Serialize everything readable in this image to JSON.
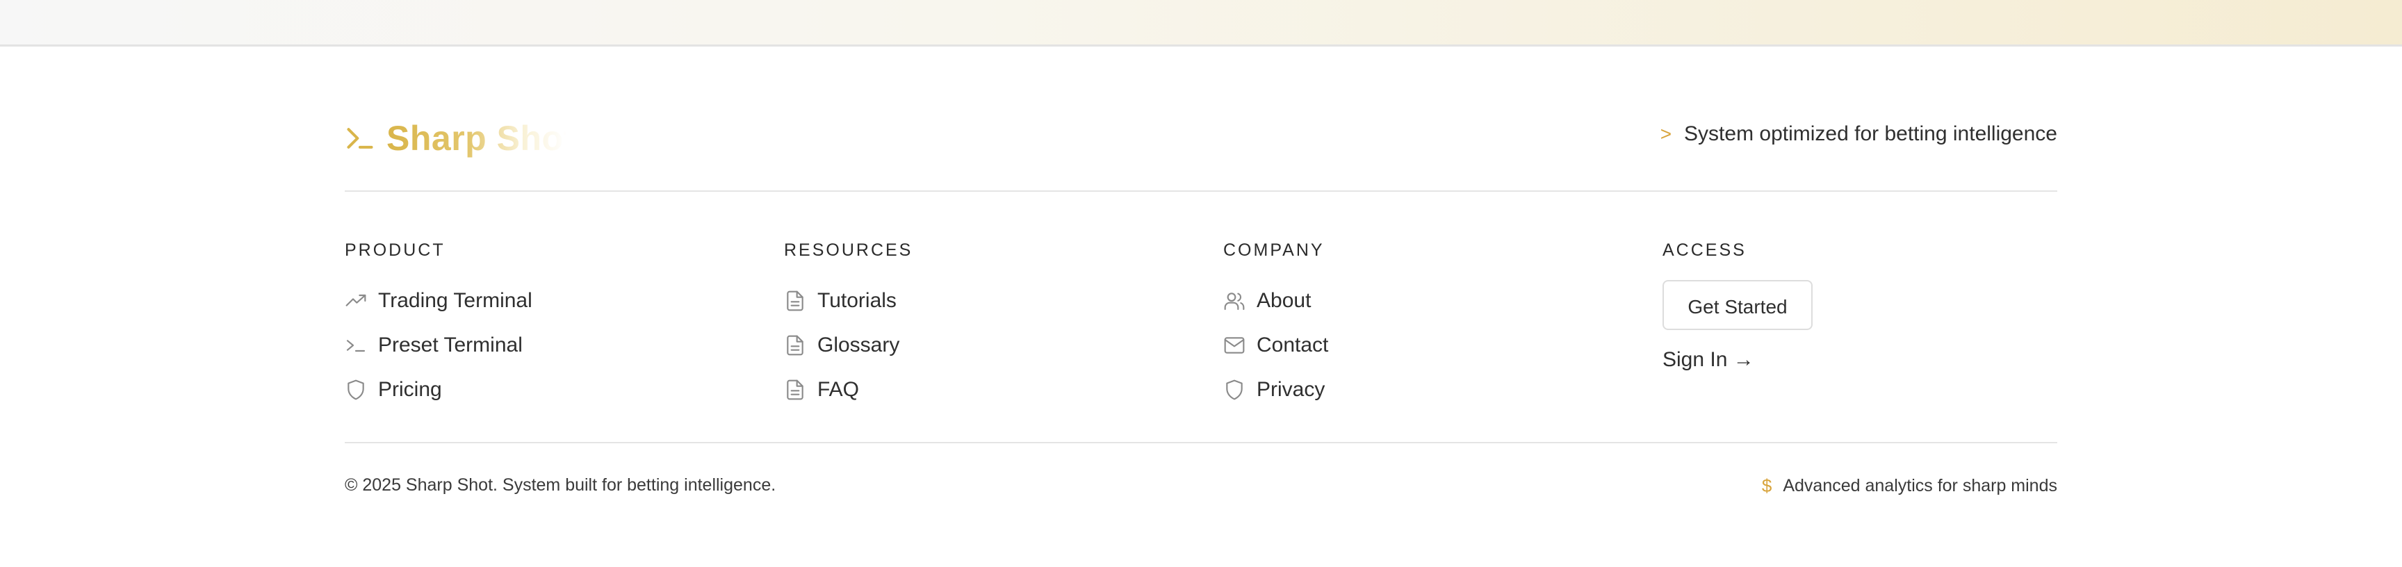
{
  "brand": {
    "name": "Sharp Shot",
    "icon": "terminal-prompt-icon",
    "accent": "#d9b54a"
  },
  "tagline": {
    "caret": ">",
    "text": "System optimized for betting intelligence"
  },
  "columns": {
    "product": {
      "heading": "PRODUCT",
      "items": [
        {
          "label": "Trading Terminal",
          "icon": "trending-up-icon"
        },
        {
          "label": "Preset Terminal",
          "icon": "terminal-icon"
        },
        {
          "label": "Pricing",
          "icon": "shield-icon"
        }
      ]
    },
    "resources": {
      "heading": "RESOURCES",
      "items": [
        {
          "label": "Tutorials",
          "icon": "document-icon"
        },
        {
          "label": "Glossary",
          "icon": "document-icon"
        },
        {
          "label": "FAQ",
          "icon": "document-icon"
        }
      ]
    },
    "company": {
      "heading": "COMPANY",
      "items": [
        {
          "label": "About",
          "icon": "users-icon"
        },
        {
          "label": "Contact",
          "icon": "mail-icon"
        },
        {
          "label": "Privacy",
          "icon": "shield-icon"
        }
      ]
    },
    "access": {
      "heading": "ACCESS",
      "get_started": "Get Started",
      "sign_in": "Sign In →"
    }
  },
  "footer": {
    "copyright": "© 2025 Sharp Shot. System built for betting intelligence.",
    "analytics_symbol": "$",
    "analytics_text": "Advanced analytics for sharp minds"
  }
}
